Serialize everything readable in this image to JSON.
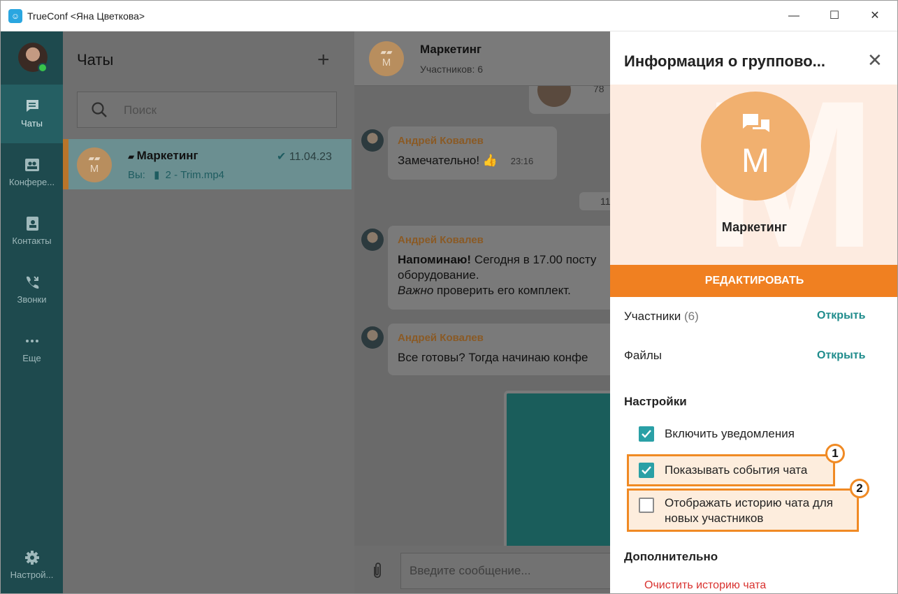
{
  "window": {
    "title": "TrueConf <Яна Цветкова>",
    "controls": [
      "—",
      "☐",
      "✕"
    ]
  },
  "rail": {
    "items": [
      {
        "label": "Чаты",
        "icon": "chat-icon",
        "active": true
      },
      {
        "label": "Конфере...",
        "icon": "conference-icon"
      },
      {
        "label": "Контакты",
        "icon": "contacts-icon"
      },
      {
        "label": "Звонки",
        "icon": "calls-icon"
      },
      {
        "label": "Еще",
        "icon": "more-icon"
      },
      {
        "label": "Настрой...",
        "icon": "gear-icon"
      }
    ]
  },
  "chats": {
    "title": "Чаты",
    "add": "+",
    "search_placeholder": "Поиск",
    "entry": {
      "name": "Маркетинг",
      "avatar_letter": "М",
      "date": "11.04.23",
      "sub_prefix": "Вы:",
      "sub_file": "2 - Trim.mp4"
    }
  },
  "conversation": {
    "name": "Маркетинг",
    "avatar_letter": "М",
    "members": "Участников: 6",
    "top_image_num": "78",
    "date_chip": "11",
    "messages": [
      {
        "author": "Андрей Ковалев",
        "text": "Замечательно!",
        "emoji": "👍",
        "time": "23:16"
      },
      {
        "author": "Андрей Ковалев",
        "bold": "Напоминаю!",
        "line1": " Сегодня в 17.00 посту",
        "line2": "оборудование.",
        "italic": "Важно",
        "line3": " проверить его комплект."
      },
      {
        "author": "Андрей Ковалев",
        "text": "Все готовы? Тогда начинаю конфе"
      }
    ],
    "input_placeholder": "Введите сообщение..."
  },
  "info": {
    "title": "Информация о группово...",
    "close": "✕",
    "avatar_letter": "М",
    "watermark": "М",
    "group_name": "Маркетинг",
    "edit_button": "РЕДАКТИРОВАТЬ",
    "participants_label": "Участники",
    "participants_count": "(6)",
    "files_label": "Файлы",
    "open_label": "Открыть",
    "settings_heading": "Настройки",
    "opt_notifications": "Включить уведомления",
    "opt_events": "Показывать события чата",
    "opt_history_1": "Отображать историю чата для",
    "opt_history_2": "новых участников",
    "callout_1": "1",
    "callout_2": "2",
    "additional_heading": "Дополнительно",
    "clear_history": "Очистить историю чата"
  },
  "colors": {
    "accent": "#f08021",
    "link": "#1f8c8c",
    "checkbox": "#2aa0a6",
    "danger": "#d9322f",
    "rail": "#1e4a4e"
  }
}
